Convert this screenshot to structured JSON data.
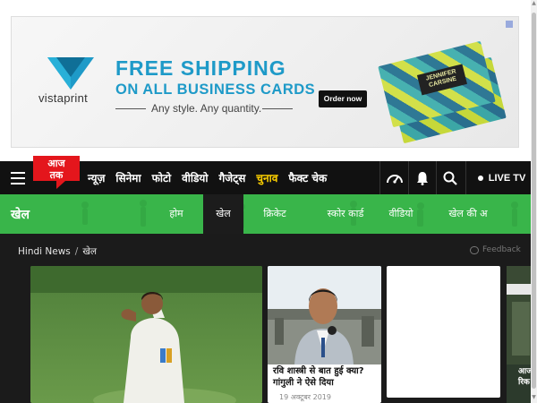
{
  "ad": {
    "brand": "vistaprint",
    "headline_line1": "FREE SHIPPING",
    "headline_line2": "ON ALL BUSINESS CARDS",
    "tagline": "Any style. Any quantity.",
    "button_label": "Order now",
    "card_name": "JENNIFER CARSINE",
    "colors": {
      "headline": "#1e9ac8",
      "button_bg": "#111111"
    }
  },
  "header": {
    "logo_text": "आज तक",
    "nav_links": [
      "न्यूज़",
      "सिनेमा",
      "फोटो",
      "वीडियो",
      "गैजेट्स",
      "चुनाव",
      "फैक्ट चेक"
    ],
    "highlight_link_index": 5,
    "live_tv_label": "LIVE TV",
    "icons": [
      "menu-icon",
      "speed-gauge-icon",
      "bell-icon",
      "search-icon",
      "live-dot-icon"
    ],
    "colors": {
      "logo_red": "#e4161c",
      "highlight": "#ffd200",
      "nav_bg": "#111111"
    }
  },
  "subnav": {
    "section_title": "खेल",
    "items": [
      {
        "label": "होम",
        "active": false
      },
      {
        "label": "खेल",
        "active": true
      },
      {
        "label": "क्रिकेट",
        "active": false
      },
      {
        "label": "स्कोर कार्ड",
        "active": false
      },
      {
        "label": "वीडियो",
        "active": false
      },
      {
        "label": "खेल की अ",
        "active": false
      }
    ],
    "colors": {
      "bg": "#39b54a",
      "active_bg": "#1c1c1c"
    }
  },
  "breadcrumb": {
    "items": [
      "Hindi News",
      "खेल"
    ],
    "separator": "/"
  },
  "feedback_label": "Feedback",
  "stories": [
    {
      "title": "",
      "date": ""
    },
    {
      "title": "रवि शास्त्री से बात हुई क्या? गांगुली ने ऐसे दिया",
      "date": "19 अक्टूबर 2019"
    },
    {
      "title": "",
      "date": ""
    },
    {
      "title": "आज\nरिक",
      "date": ""
    }
  ]
}
